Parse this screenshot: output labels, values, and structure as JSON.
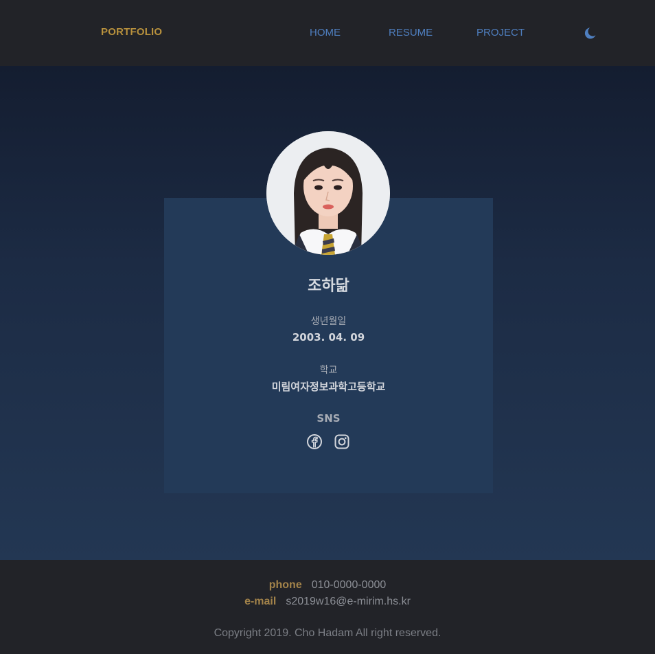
{
  "nav": {
    "brand": "PORTFOLIO",
    "links": [
      "HOME",
      "RESUME",
      "PROJECT"
    ],
    "theme_icon": "moon-icon"
  },
  "profile": {
    "name": "조하닮",
    "birth_label": "생년월일",
    "birth_value": "2003. 04. 09",
    "school_label": "학교",
    "school_value": "미림여자정보과학고등학교",
    "sns_label": "SNS",
    "sns_icons": [
      "facebook-icon",
      "instagram-icon"
    ]
  },
  "footer": {
    "phone_label": "phone",
    "phone_value": "010-0000-0000",
    "email_label": "e-mail",
    "email_value": "s2019w16@e-mirim.hs.kr",
    "copyright": "Copyright 2019. Cho Hadam All right reserved."
  },
  "colors": {
    "brand": "#b8913d",
    "nav_link": "#4f7fc0",
    "card": "#233a58",
    "footer_bg": "#222328"
  }
}
